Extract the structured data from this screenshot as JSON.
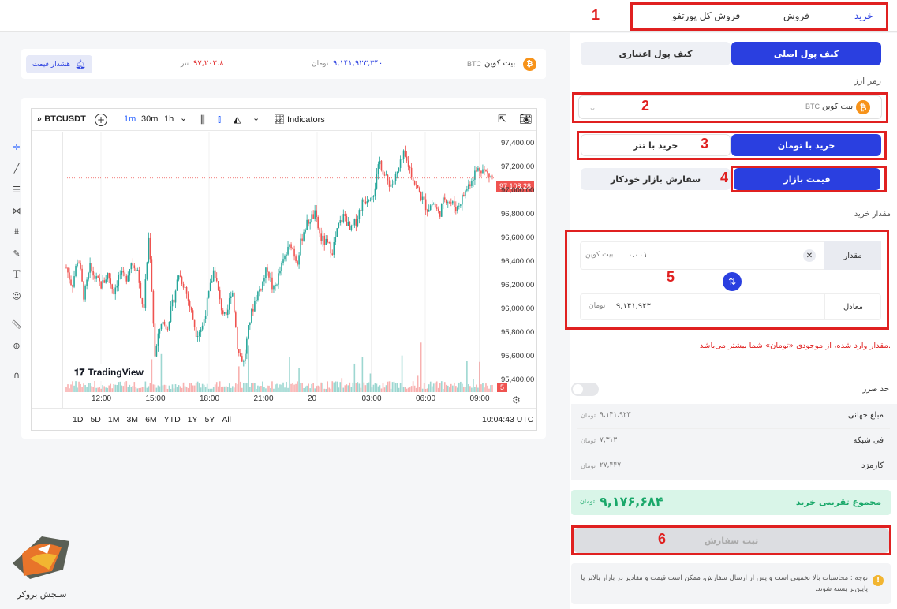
{
  "tabs": {
    "buy": "خرید",
    "sell": "فروش",
    "sell_portfolio": "فروش کل پورتفو"
  },
  "wallet": {
    "main": "کیف پول اصلی",
    "credit": "کیف پول اعتباری"
  },
  "currency": {
    "label": "رمز ارز",
    "name": "بیت کوین",
    "symbol": "BTC"
  },
  "buy_with": {
    "toman": "خرید با تومان",
    "tether": "خرید با تتر"
  },
  "order_type": {
    "market": "قیمت بازار",
    "auto": "سفارش بازار خودکار"
  },
  "amount": {
    "section_label": "مقدار خرید",
    "amount_label": "مقدار",
    "amount_value": "۰.۰۰۱",
    "amount_unit": "بیت کوین",
    "equiv_label": "معادل",
    "equiv_value": "۹,۱۴۱,۹۲۳",
    "equiv_unit": "تومان"
  },
  "warning": "مقدار وارد شده، از موجودی «تومان» شما بیشتر می‌باشد.",
  "stop_loss": "حد ضرر",
  "summary": [
    {
      "label": "مبلغ جهانی",
      "value": "۹,۱۴۱,۹۲۳",
      "unit": "تومان"
    },
    {
      "label": "فی شبکه",
      "value": "۷,۳۱۳",
      "unit": "تومان"
    },
    {
      "label": "کارمزد",
      "value": "۲۷,۴۴۷",
      "unit": "تومان"
    }
  ],
  "total": {
    "label": "مجموع تقریبی خرید",
    "value": "۹,۱۷۶,۶۸۴",
    "unit": "تومان"
  },
  "submit": "ثبت سفارش",
  "note": "توجه : محاسبات بالا تخمینی است و پس از ارسال سفارش، ممکن است قیمت و مقادیر در بازار بالاتر یا پایین‌تر بسته شوند.",
  "steps": [
    "1",
    "2",
    "3",
    "4",
    "5",
    "6"
  ],
  "ticker": {
    "name": "بیت کوین",
    "symbol": "BTC",
    "toman_price": "۹,۱۴۱,۹۲۳,۳۴۰",
    "toman_unit": "تومان",
    "tether_price": "۹۷,۲۰۲.۸",
    "tether_unit": "تتر",
    "alert": "هشدار قیمت"
  },
  "chart_toolbar": {
    "symbol": "BTCUSDT",
    "intervals": [
      "1m",
      "30m",
      "1h"
    ],
    "indicators": "Indicators"
  },
  "chart_data": {
    "type": "candlestick",
    "y_ticks": [
      "97,400.00",
      "97,200.00",
      "97,000.00",
      "96,800.00",
      "96,600.00",
      "96,400.00",
      "96,200.00",
      "96,000.00",
      "95,800.00",
      "95,600.00",
      "95,400.00"
    ],
    "x_ticks": [
      "12:00",
      "15:00",
      "18:00",
      "21:00",
      "20",
      "03:00",
      "06:00",
      "09:00"
    ],
    "last_price": "97,108.28",
    "ylim": [
      95300,
      97500
    ],
    "close_path": [
      96350,
      96200,
      96450,
      96100,
      96350,
      96250,
      96200,
      96300,
      96150,
      96300,
      96250,
      96400,
      96350,
      95950,
      96650,
      95600,
      95900,
      95850,
      96050,
      96300,
      96200,
      96000,
      95800,
      95850,
      96100,
      96350,
      96050,
      95900,
      96200,
      95650,
      95550,
      95900,
      96100,
      96200,
      96350,
      96150,
      96300,
      96450,
      96550,
      96400,
      96650,
      96750,
      96800,
      96600,
      96550,
      96500,
      96700,
      96800,
      96650,
      96750,
      96900,
      96950,
      97000,
      97250,
      97100,
      97050,
      97150,
      97300,
      97200,
      97050,
      96950,
      96850,
      96900,
      96800,
      96950,
      96900,
      96850,
      96950,
      97050,
      97150,
      97200,
      97150,
      97108
    ]
  },
  "chart_bottom": {
    "ranges": [
      "1D",
      "5D",
      "1M",
      "3M",
      "6M",
      "YTD",
      "1Y",
      "5Y",
      "All"
    ],
    "time": "10:04:43 UTC"
  },
  "watermark": "TradingView",
  "brand": "سنجش بروکر",
  "colors": {
    "primary": "#2a3fe0",
    "danger": "#e02020",
    "success": "#1aa86a",
    "bitcoin": "#f7931a",
    "up": "#26a69a",
    "down": "#ef5350"
  }
}
